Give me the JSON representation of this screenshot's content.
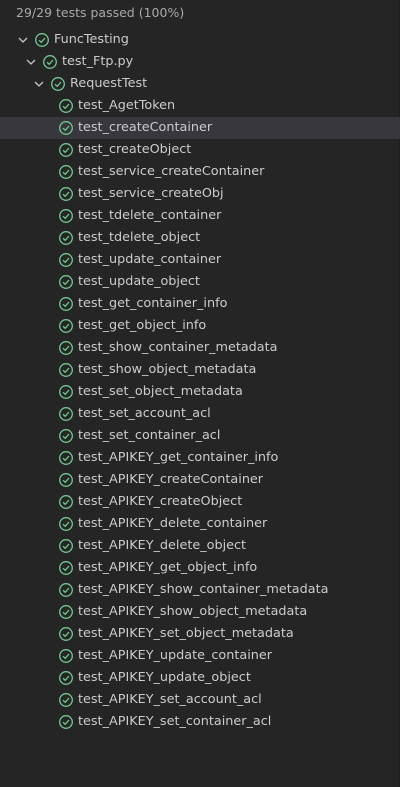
{
  "summary": "29/29 tests passed (100%)",
  "colors": {
    "pass": "#73c991",
    "background": "#252526",
    "selected": "#37373d"
  },
  "icons": {
    "expanded": "chevron-down-icon",
    "passed": "check-circle-icon"
  },
  "tree": {
    "suite": "FuncTesting",
    "file": "test_Ftp.py",
    "class": "RequestTest",
    "selected_test": "test_createContainer",
    "tests": [
      "test_AgetToken",
      "test_createContainer",
      "test_createObject",
      "test_service_createContainer",
      "test_service_createObj",
      "test_tdelete_container",
      "test_tdelete_object",
      "test_update_container",
      "test_update_object",
      "test_get_container_info",
      "test_get_object_info",
      "test_show_container_metadata",
      "test_show_object_metadata",
      "test_set_object_metadata",
      "test_set_account_acl",
      "test_set_container_acl",
      "test_APIKEY_get_container_info",
      "test_APIKEY_createContainer",
      "test_APIKEY_createObject",
      "test_APIKEY_delete_container",
      "test_APIKEY_delete_object",
      "test_APIKEY_get_object_info",
      "test_APIKEY_show_container_metadata",
      "test_APIKEY_show_object_metadata",
      "test_APIKEY_set_object_metadata",
      "test_APIKEY_update_container",
      "test_APIKEY_update_object",
      "test_APIKEY_set_account_acl",
      "test_APIKEY_set_container_acl"
    ]
  }
}
